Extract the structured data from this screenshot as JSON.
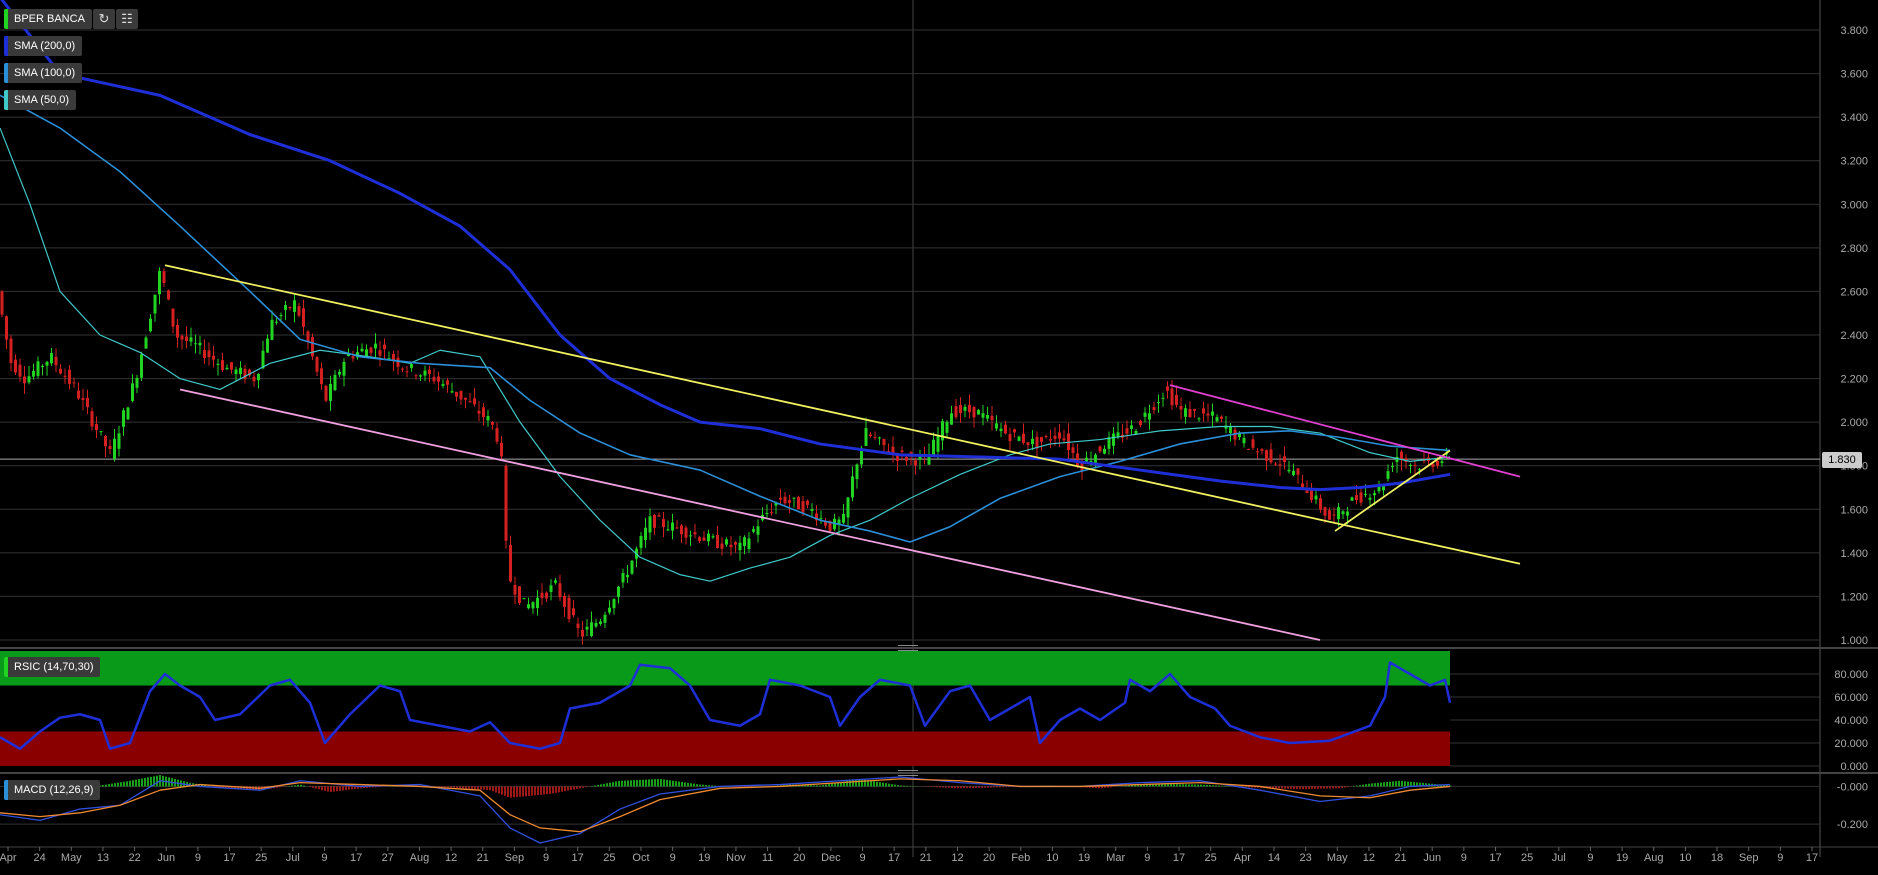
{
  "symbol": "BPER BANCA",
  "toolbar": {
    "refresh_icon": "refresh-icon",
    "settings_icon": "chart-settings-icon"
  },
  "indicators": {
    "sma200": {
      "label": "SMA (200,0)",
      "color": "#1e2fd8"
    },
    "sma100": {
      "label": "SMA (100,0)",
      "color": "#2a8fd8"
    },
    "sma50": {
      "label": "SMA (50,0)",
      "color": "#40c9c9"
    },
    "rsi": {
      "label": "RSIC (14,70,30)"
    },
    "macd": {
      "label": "MACD (12,26,9)"
    }
  },
  "last_price": "1.830",
  "colors": {
    "up": "#22d422",
    "down": "#d42020",
    "trend_yellow": "#f0f060",
    "trend_pink": "#f0a0e0",
    "trend_magenta": "#e040d0"
  },
  "chart_data": [
    {
      "type": "candlestick",
      "title": "BPER BANCA",
      "ylim": [
        1.0,
        3.9
      ],
      "y_ticks": [
        "3.800",
        "3.600",
        "3.400",
        "3.200",
        "3.000",
        "2.800",
        "2.600",
        "2.400",
        "2.200",
        "2.000",
        "1.800",
        "1.600",
        "1.400",
        "1.200",
        "1.000"
      ],
      "x_ticks": [
        "Apr",
        "24",
        "May",
        "13",
        "22",
        "Jun",
        "9",
        "17",
        "25",
        "Jul",
        "9",
        "17",
        "27",
        "Aug",
        "12",
        "21",
        "Sep",
        "9",
        "17",
        "25",
        "Oct",
        "9",
        "19",
        "Nov",
        "11",
        "20",
        "Dec",
        "9",
        "17",
        "21",
        "12",
        "20",
        "Feb",
        "10",
        "19",
        "Mar",
        "9",
        "17",
        "25",
        "Apr",
        "14",
        "23",
        "May",
        "12",
        "21",
        "Jun",
        "9",
        "17",
        "25",
        "Jul",
        "9",
        "19",
        "Aug",
        "10",
        "18",
        "Sep",
        "9",
        "17"
      ],
      "price_path": [
        [
          0,
          2.65
        ],
        [
          15,
          2.28
        ],
        [
          30,
          2.2
        ],
        [
          55,
          2.3
        ],
        [
          80,
          2.15
        ],
        [
          115,
          1.85
        ],
        [
          140,
          2.2
        ],
        [
          165,
          2.7
        ],
        [
          180,
          2.4
        ],
        [
          200,
          2.35
        ],
        [
          230,
          2.25
        ],
        [
          260,
          2.2
        ],
        [
          275,
          2.45
        ],
        [
          300,
          2.55
        ],
        [
          330,
          2.1
        ],
        [
          350,
          2.3
        ],
        [
          380,
          2.35
        ],
        [
          410,
          2.25
        ],
        [
          440,
          2.2
        ],
        [
          470,
          2.1
        ],
        [
          495,
          2.0
        ],
        [
          505,
          1.9
        ],
        [
          512,
          1.3
        ],
        [
          530,
          1.15
        ],
        [
          560,
          1.25
        ],
        [
          585,
          1.02
        ],
        [
          605,
          1.1
        ],
        [
          630,
          1.3
        ],
        [
          655,
          1.55
        ],
        [
          690,
          1.5
        ],
        [
          720,
          1.45
        ],
        [
          745,
          1.42
        ],
        [
          765,
          1.55
        ],
        [
          785,
          1.65
        ],
        [
          815,
          1.6
        ],
        [
          835,
          1.52
        ],
        [
          848,
          1.55
        ],
        [
          860,
          1.8
        ],
        [
          870,
          1.95
        ],
        [
          900,
          1.85
        ],
        [
          930,
          1.82
        ],
        [
          955,
          2.05
        ],
        [
          980,
          2.05
        ],
        [
          1010,
          1.95
        ],
        [
          1040,
          1.9
        ],
        [
          1065,
          1.95
        ],
        [
          1085,
          1.8
        ],
        [
          1110,
          1.9
        ],
        [
          1140,
          1.98
        ],
        [
          1170,
          2.15
        ],
        [
          1185,
          2.05
        ],
        [
          1220,
          2.02
        ],
        [
          1250,
          1.9
        ],
        [
          1290,
          1.8
        ],
        [
          1310,
          1.7
        ],
        [
          1335,
          1.55
        ],
        [
          1360,
          1.65
        ],
        [
          1385,
          1.7
        ],
        [
          1400,
          1.85
        ],
        [
          1420,
          1.8
        ],
        [
          1450,
          1.83
        ]
      ],
      "sma200": [
        [
          0,
          3.95
        ],
        [
          60,
          3.6
        ],
        [
          160,
          3.5
        ],
        [
          250,
          3.32
        ],
        [
          330,
          3.2
        ],
        [
          400,
          3.05
        ],
        [
          460,
          2.9
        ],
        [
          510,
          2.7
        ],
        [
          560,
          2.4
        ],
        [
          610,
          2.2
        ],
        [
          660,
          2.08
        ],
        [
          700,
          2.0
        ],
        [
          760,
          1.97
        ],
        [
          820,
          1.9
        ],
        [
          900,
          1.85
        ],
        [
          980,
          1.84
        ],
        [
          1060,
          1.83
        ],
        [
          1140,
          1.78
        ],
        [
          1220,
          1.73
        ],
        [
          1280,
          1.7
        ],
        [
          1320,
          1.69
        ],
        [
          1360,
          1.7
        ],
        [
          1400,
          1.72
        ],
        [
          1450,
          1.76
        ]
      ],
      "sma100": [
        [
          0,
          3.5
        ],
        [
          60,
          3.35
        ],
        [
          120,
          3.15
        ],
        [
          180,
          2.9
        ],
        [
          250,
          2.6
        ],
        [
          300,
          2.38
        ],
        [
          360,
          2.3
        ],
        [
          420,
          2.27
        ],
        [
          490,
          2.25
        ],
        [
          530,
          2.1
        ],
        [
          580,
          1.95
        ],
        [
          630,
          1.85
        ],
        [
          700,
          1.78
        ],
        [
          760,
          1.66
        ],
        [
          820,
          1.55
        ],
        [
          870,
          1.5
        ],
        [
          910,
          1.45
        ],
        [
          950,
          1.52
        ],
        [
          1000,
          1.65
        ],
        [
          1060,
          1.75
        ],
        [
          1120,
          1.82
        ],
        [
          1180,
          1.9
        ],
        [
          1240,
          1.95
        ],
        [
          1290,
          1.96
        ],
        [
          1340,
          1.93
        ],
        [
          1390,
          1.89
        ],
        [
          1450,
          1.87
        ]
      ],
      "sma50": [
        [
          0,
          3.35
        ],
        [
          30,
          3.0
        ],
        [
          60,
          2.6
        ],
        [
          100,
          2.4
        ],
        [
          140,
          2.32
        ],
        [
          180,
          2.2
        ],
        [
          220,
          2.15
        ],
        [
          270,
          2.27
        ],
        [
          320,
          2.33
        ],
        [
          370,
          2.3
        ],
        [
          410,
          2.27
        ],
        [
          440,
          2.33
        ],
        [
          480,
          2.3
        ],
        [
          520,
          2.0
        ],
        [
          560,
          1.75
        ],
        [
          600,
          1.55
        ],
        [
          640,
          1.38
        ],
        [
          680,
          1.3
        ],
        [
          710,
          1.27
        ],
        [
          750,
          1.33
        ],
        [
          790,
          1.38
        ],
        [
          830,
          1.48
        ],
        [
          870,
          1.55
        ],
        [
          910,
          1.65
        ],
        [
          960,
          1.76
        ],
        [
          1010,
          1.85
        ],
        [
          1050,
          1.9
        ],
        [
          1100,
          1.92
        ],
        [
          1160,
          1.96
        ],
        [
          1220,
          1.98
        ],
        [
          1270,
          1.98
        ],
        [
          1320,
          1.95
        ],
        [
          1370,
          1.86
        ],
        [
          1410,
          1.82
        ],
        [
          1450,
          1.84
        ]
      ],
      "trendlines": [
        {
          "color_key": "trend_yellow",
          "from": [
            165,
            2.72
          ],
          "to": [
            1520,
            1.35
          ]
        },
        {
          "color_key": "trend_yellow",
          "from": [
            1335,
            1.5
          ],
          "to": [
            1450,
            1.87
          ]
        },
        {
          "color_key": "trend_pink",
          "from": [
            180,
            2.15
          ],
          "to": [
            1320,
            1.0
          ]
        },
        {
          "color_key": "trend_magenta",
          "from": [
            1170,
            2.17
          ],
          "to": [
            1520,
            1.75
          ]
        }
      ]
    },
    {
      "type": "line",
      "title": "RSIC (14,70,30)",
      "ylim": [
        0,
        100
      ],
      "y_ticks": [
        "80.000",
        "60.000",
        "40.000",
        "20.000",
        "0.000"
      ],
      "overbought": 70,
      "oversold": 30,
      "values": [
        [
          0,
          25
        ],
        [
          20,
          15
        ],
        [
          40,
          30
        ],
        [
          60,
          42
        ],
        [
          80,
          45
        ],
        [
          100,
          40
        ],
        [
          110,
          15
        ],
        [
          130,
          20
        ],
        [
          150,
          65
        ],
        [
          165,
          80
        ],
        [
          180,
          70
        ],
        [
          200,
          60
        ],
        [
          215,
          40
        ],
        [
          240,
          45
        ],
        [
          270,
          70
        ],
        [
          290,
          75
        ],
        [
          310,
          55
        ],
        [
          325,
          20
        ],
        [
          350,
          45
        ],
        [
          380,
          70
        ],
        [
          400,
          65
        ],
        [
          410,
          40
        ],
        [
          440,
          35
        ],
        [
          470,
          30
        ],
        [
          490,
          38
        ],
        [
          510,
          20
        ],
        [
          540,
          15
        ],
        [
          560,
          20
        ],
        [
          570,
          50
        ],
        [
          600,
          55
        ],
        [
          630,
          70
        ],
        [
          640,
          88
        ],
        [
          670,
          85
        ],
        [
          690,
          70
        ],
        [
          710,
          40
        ],
        [
          740,
          35
        ],
        [
          760,
          45
        ],
        [
          770,
          75
        ],
        [
          800,
          70
        ],
        [
          830,
          60
        ],
        [
          840,
          35
        ],
        [
          860,
          60
        ],
        [
          880,
          75
        ],
        [
          910,
          70
        ],
        [
          925,
          35
        ],
        [
          950,
          65
        ],
        [
          970,
          70
        ],
        [
          990,
          40
        ],
        [
          1010,
          50
        ],
        [
          1030,
          60
        ],
        [
          1040,
          20
        ],
        [
          1060,
          40
        ],
        [
          1080,
          50
        ],
        [
          1100,
          40
        ],
        [
          1125,
          55
        ],
        [
          1130,
          75
        ],
        [
          1150,
          65
        ],
        [
          1170,
          80
        ],
        [
          1190,
          60
        ],
        [
          1215,
          50
        ],
        [
          1230,
          35
        ],
        [
          1260,
          25
        ],
        [
          1290,
          20
        ],
        [
          1330,
          22
        ],
        [
          1370,
          35
        ],
        [
          1385,
          60
        ],
        [
          1390,
          90
        ],
        [
          1410,
          80
        ],
        [
          1430,
          70
        ],
        [
          1445,
          75
        ],
        [
          1450,
          55
        ]
      ]
    },
    {
      "type": "bar",
      "title": "MACD (12,26,9)",
      "ylim": [
        -0.3,
        0.05
      ],
      "y_ticks": [
        "-0.000",
        "-0.200"
      ],
      "histogram": [
        [
          100,
          0.005
        ],
        [
          130,
          0.03
        ],
        [
          160,
          0.06
        ],
        [
          190,
          0.02
        ],
        [
          220,
          -0.01
        ],
        [
          260,
          -0.02
        ],
        [
          300,
          0.01
        ],
        [
          330,
          -0.03
        ],
        [
          360,
          -0.01
        ],
        [
          400,
          0.005
        ],
        [
          450,
          -0.005
        ],
        [
          490,
          -0.02
        ],
        [
          510,
          -0.06
        ],
        [
          550,
          -0.04
        ],
        [
          580,
          -0.01
        ],
        [
          620,
          0.03
        ],
        [
          660,
          0.04
        ],
        [
          700,
          0.01
        ],
        [
          750,
          -0.01
        ],
        [
          790,
          0.01
        ],
        [
          820,
          0.005
        ],
        [
          860,
          0.04
        ],
        [
          900,
          0.005
        ],
        [
          960,
          -0.01
        ],
        [
          1000,
          -0.005
        ],
        [
          1050,
          0.005
        ],
        [
          1100,
          -0.01
        ],
        [
          1150,
          0.015
        ],
        [
          1200,
          0.01
        ],
        [
          1250,
          -0.005
        ],
        [
          1300,
          -0.015
        ],
        [
          1340,
          -0.01
        ],
        [
          1370,
          0.015
        ],
        [
          1400,
          0.03
        ],
        [
          1430,
          0.015
        ],
        [
          1450,
          0.005
        ]
      ],
      "macd_line": [
        [
          0,
          -0.15
        ],
        [
          40,
          -0.18
        ],
        [
          80,
          -0.12
        ],
        [
          120,
          -0.1
        ],
        [
          160,
          0.03
        ],
        [
          200,
          0.0
        ],
        [
          260,
          -0.02
        ],
        [
          300,
          0.03
        ],
        [
          360,
          0.0
        ],
        [
          420,
          0.01
        ],
        [
          480,
          -0.05
        ],
        [
          510,
          -0.22
        ],
        [
          540,
          -0.3
        ],
        [
          580,
          -0.25
        ],
        [
          620,
          -0.12
        ],
        [
          660,
          -0.04
        ],
        [
          720,
          0.0
        ],
        [
          780,
          0.01
        ],
        [
          840,
          0.03
        ],
        [
          900,
          0.05
        ],
        [
          960,
          0.02
        ],
        [
          1020,
          0.0
        ],
        [
          1080,
          0.0
        ],
        [
          1140,
          0.02
        ],
        [
          1200,
          0.03
        ],
        [
          1260,
          -0.02
        ],
        [
          1320,
          -0.08
        ],
        [
          1370,
          -0.05
        ],
        [
          1410,
          0.0
        ],
        [
          1450,
          0.01
        ]
      ],
      "signal_line": [
        [
          0,
          -0.14
        ],
        [
          40,
          -0.16
        ],
        [
          80,
          -0.14
        ],
        [
          120,
          -0.1
        ],
        [
          160,
          -0.02
        ],
        [
          200,
          0.01
        ],
        [
          260,
          -0.01
        ],
        [
          300,
          0.02
        ],
        [
          360,
          0.01
        ],
        [
          420,
          0.0
        ],
        [
          480,
          -0.02
        ],
        [
          510,
          -0.15
        ],
        [
          540,
          -0.22
        ],
        [
          580,
          -0.24
        ],
        [
          620,
          -0.16
        ],
        [
          660,
          -0.07
        ],
        [
          720,
          -0.01
        ],
        [
          780,
          0.0
        ],
        [
          840,
          0.02
        ],
        [
          900,
          0.04
        ],
        [
          960,
          0.03
        ],
        [
          1020,
          0.0
        ],
        [
          1080,
          0.0
        ],
        [
          1140,
          0.01
        ],
        [
          1200,
          0.02
        ],
        [
          1260,
          0.0
        ],
        [
          1320,
          -0.05
        ],
        [
          1370,
          -0.06
        ],
        [
          1410,
          -0.02
        ],
        [
          1450,
          0.0
        ]
      ]
    }
  ]
}
